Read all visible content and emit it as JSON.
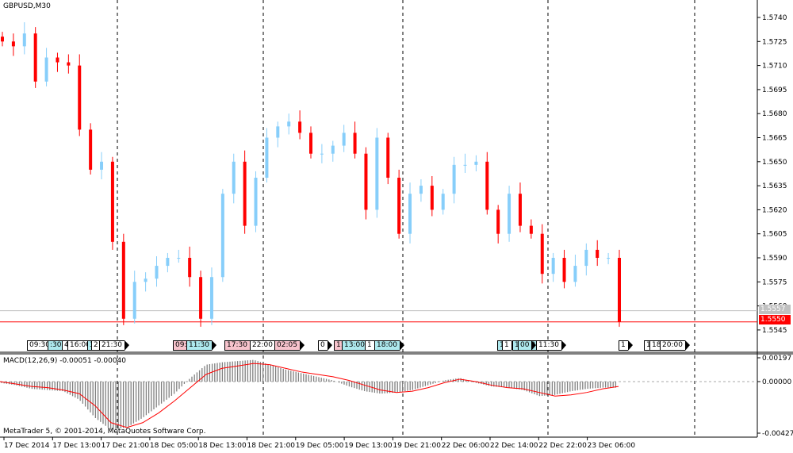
{
  "symbol_title": "GBPUSD,M30",
  "macd_title": "MACD(12,26,9) -0.00051 -0.00040",
  "copyright": "MetaTrader 5, © 2001-2014, MetaQuotes Software Corp.",
  "colors": {
    "bull": "#87cefa",
    "bear": "#ff0000",
    "signal": "#ff0000",
    "hist": "#808080",
    "grid": "#000000",
    "bid_line": "#ff0000",
    "ask_line": "#c0c0c0"
  },
  "current_price": {
    "ask": "1.5557",
    "bid": "1.5550",
    "ask_value": 1.5557,
    "bid_value": 1.555
  },
  "events": [
    {
      "t": "09:30",
      "c": ""
    },
    {
      "t": ":30",
      "c": "cyan"
    },
    {
      "t": "4",
      "c": ""
    },
    {
      "t": "16:00",
      "c": ""
    },
    {
      "t": "3",
      "c": "cyan"
    },
    {
      "t": "2",
      "c": ""
    },
    {
      "t": "21:30",
      "c": ""
    },
    {
      "t": "09:",
      "c": "pink"
    },
    {
      "t": "11:30",
      "c": "cyan"
    },
    {
      "t": "17:30",
      "c": "pink"
    },
    {
      "t": "22:00",
      "c": ""
    },
    {
      "t": "02:05",
      "c": "pink"
    },
    {
      "t": "0",
      "c": ""
    },
    {
      "t": "11",
      "c": "pink"
    },
    {
      "t": "13:00",
      "c": "cyan"
    },
    {
      "t": "1",
      "c": ""
    },
    {
      "t": "18:00",
      "c": "cyan"
    },
    {
      "t": "1",
      "c": "cyan"
    },
    {
      "t": "1",
      "c": ""
    },
    {
      "t": "18:30",
      "c": "cyan"
    },
    {
      "t": "00",
      "c": "cyan"
    },
    {
      "t": "11:30",
      "c": ""
    },
    {
      "t": "1",
      "c": ""
    },
    {
      "t": "17",
      "c": ""
    },
    {
      "t": "18",
      "c": ""
    },
    {
      "t": "20:00",
      "c": ""
    }
  ],
  "chart_data": [
    {
      "type": "candlestick",
      "title": "GBPUSD,M30",
      "ylim": [
        1.5538,
        1.5748
      ],
      "y_ticks": [
        "1.5740",
        "1.5725",
        "1.5710",
        "1.5695",
        "1.5680",
        "1.5665",
        "1.5650",
        "1.5635",
        "1.5620",
        "1.5605",
        "1.5590",
        "1.5575",
        "1.5560",
        "1.5545"
      ],
      "x_ticks": [
        "17 Dec 2014",
        "17 Dec 13:00",
        "17 Dec 21:00",
        "18 Dec 05:00",
        "18 Dec 13:00",
        "18 Dec 21:00",
        "19 Dec 05:00",
        "19 Dec 13:00",
        "19 Dec 21:00",
        "22 Dec 06:00",
        "22 Dec 14:00",
        "22 Dec 22:00",
        "23 Dec 06:00"
      ],
      "closes": [
        1.5725,
        1.5722,
        1.573,
        1.57,
        1.5715,
        1.5712,
        1.571,
        1.567,
        1.5645,
        1.565,
        1.56,
        1.5552,
        1.5575,
        1.5577,
        1.5585,
        1.559,
        1.559,
        1.5578,
        1.5552,
        1.5578,
        1.563,
        1.565,
        1.561,
        1.564,
        1.5665,
        1.5672,
        1.5675,
        1.5668,
        1.5655,
        1.5655,
        1.566,
        1.5668,
        1.5655,
        1.562,
        1.5665,
        1.564,
        1.5605,
        1.563,
        1.5635,
        1.562,
        1.563,
        1.5648,
        1.5648,
        1.565,
        1.562,
        1.5605,
        1.563,
        1.561,
        1.5605,
        1.558,
        1.559,
        1.5575,
        1.5585,
        1.5595,
        1.559,
        1.559,
        1.555
      ]
    },
    {
      "type": "bar+line",
      "title": "MACD(12,26,9)",
      "ylim": [
        -0.00427,
        0.00197
      ],
      "y_ticks": [
        "0.00197",
        "0.00000",
        "-0.00427"
      ],
      "histogram": [
        -0.0001,
        -0.0003,
        -0.0006,
        -0.0007,
        -0.0008,
        -0.0015,
        -0.003,
        -0.004,
        -0.0038,
        -0.003,
        -0.002,
        -0.001,
        0.0003,
        0.0014,
        0.0016,
        0.0017,
        0.0018,
        0.0014,
        0.001,
        0.0007,
        0.0004,
        0.0001,
        -0.0004,
        -0.0008,
        -0.001,
        -0.0009,
        -0.0007,
        -0.0003,
        0.0001,
        0.0003,
        -0.0001,
        -0.0004,
        -0.0005,
        -0.0007,
        -0.0012,
        -0.0011,
        -0.0008,
        -0.0006,
        -0.0005,
        -0.0005
      ],
      "signal": [
        0.0,
        -0.0002,
        -0.0004,
        -0.0005,
        -0.0007,
        -0.001,
        -0.002,
        -0.0034,
        -0.0038,
        -0.0034,
        -0.0026,
        -0.0016,
        -0.0005,
        0.0006,
        0.0011,
        0.0013,
        0.0015,
        0.0014,
        0.0011,
        0.0008,
        0.0006,
        0.0004,
        0.0001,
        -0.0003,
        -0.0007,
        -0.0009,
        -0.0008,
        -0.0005,
        -0.0001,
        0.0002,
        0.0,
        -0.0003,
        -0.0005,
        -0.0006,
        -0.0009,
        -0.0012,
        -0.0011,
        -0.0009,
        -0.0006,
        -0.0004
      ]
    }
  ]
}
